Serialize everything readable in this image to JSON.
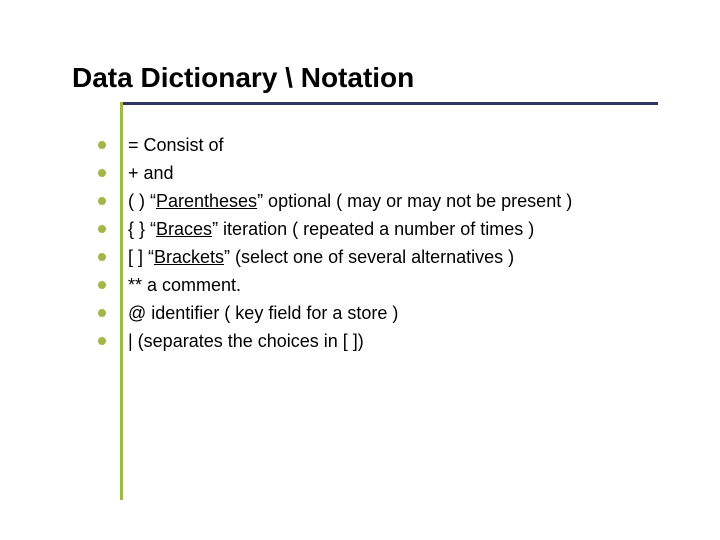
{
  "title": "Data Dictionary \\ Notation",
  "items": [
    "= Consist of",
    "+ and",
    {
      "pre": "( ) “",
      "u": "Parentheses",
      "post": "” optional ( may or may not be present )"
    },
    {
      "pre": "{ } “",
      "u": "Braces",
      "post": "” iteration ( repeated a number of times )"
    },
    {
      "pre": "[ ] “",
      "u": "Brackets",
      "post": "” (select one of several alternatives )"
    },
    "** a comment.",
    "@ identifier ( key field for a store )",
    "| (separates the choices in [ ])"
  ]
}
